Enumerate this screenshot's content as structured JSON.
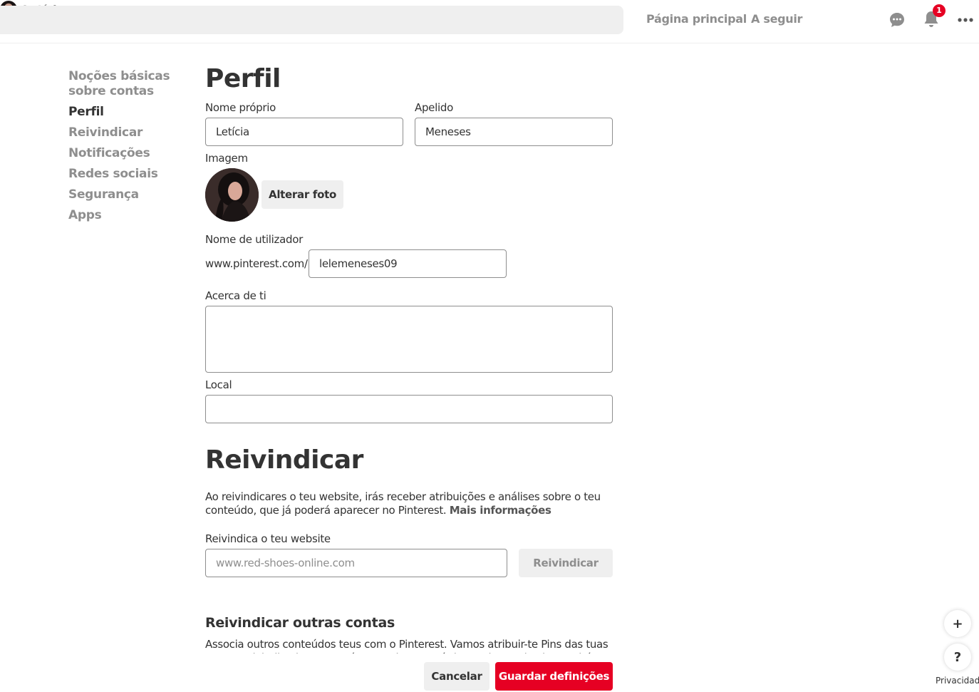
{
  "header": {
    "search_value": "",
    "nav_home": "Página principal",
    "nav_following": "A seguir",
    "user_name": "Letícia",
    "notification_count": "1"
  },
  "sidebar": {
    "items": [
      {
        "label": "Noções básicas sobre contas",
        "active": false
      },
      {
        "label": "Perfil",
        "active": true
      },
      {
        "label": "Reivindicar",
        "active": false
      },
      {
        "label": "Notificações",
        "active": false
      },
      {
        "label": "Redes sociais",
        "active": false
      },
      {
        "label": "Segurança",
        "active": false
      },
      {
        "label": "Apps",
        "active": false
      }
    ]
  },
  "profile": {
    "title": "Perfil",
    "first_name_label": "Nome próprio",
    "first_name_value": "Letícia",
    "last_name_label": "Apelido",
    "last_name_value": "Meneses",
    "image_label": "Imagem",
    "change_photo_label": "Alterar foto",
    "username_label": "Nome de utilizador",
    "username_prefix": "www.pinterest.com/",
    "username_value": "lelemeneses09",
    "about_label": "Acerca de ti",
    "about_value": "",
    "location_label": "Local",
    "location_value": ""
  },
  "claim": {
    "title": "Reivindicar",
    "description": "Ao reivindicares o teu website, irás receber atribuições e análises sobre o teu conteúdo, que já poderá aparecer no Pinterest.",
    "more_info_link": "Mais informações",
    "website_label": "Reivindica o teu website",
    "website_placeholder": "www.red-shoes-online.com",
    "claim_button": "Reivindicar",
    "other_accounts_title": "Reivindicar outras contas",
    "other_accounts_text": "Associa outros conteúdos teus com o Pinterest. Vamos atribuir-te Pins das tuas contas reivindicadas. Passarás a receber estatísticas sobre cada Pin. Também vamos"
  },
  "footer": {
    "cancel_label": "Cancelar",
    "save_label": "Guardar definições",
    "plus_label": "+",
    "help_label": "?",
    "privacy_label": "Privacidade"
  },
  "colors": {
    "accent_red": "#e60023",
    "muted_gray": "#8e8e8e",
    "text_dark": "#333333",
    "button_gray": "#efefef"
  },
  "icons": {
    "messages": "speech-bubble-icon",
    "notifications": "bell-icon",
    "more": "more-dots-icon"
  }
}
